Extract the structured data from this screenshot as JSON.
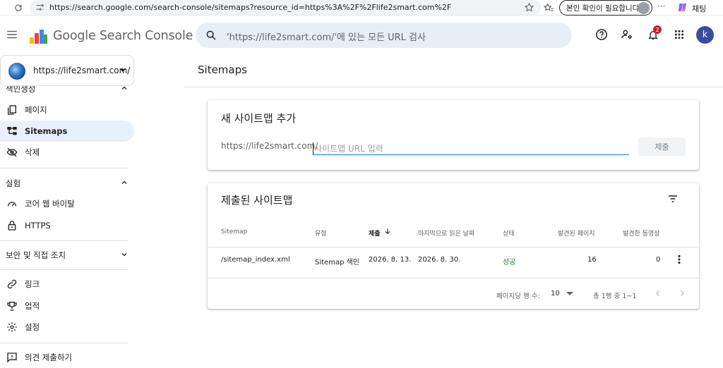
{
  "browser": {
    "url": "https://search.google.com/search-console/sitemaps?resource_id=https%3A%2F%2Flife2smart.com%2F",
    "signin_label": "본인 확인이 필요합니다.",
    "chat_label": "채팅",
    "more_label": "···"
  },
  "header": {
    "product_name": "Google Search Console",
    "search_placeholder": "'https://life2smart.com/'에 있는 모든 URL 검사",
    "notification_count": "2",
    "user_initial": "k"
  },
  "sidebar": {
    "property": "https://life2smart.com/",
    "section_indexing": "색인생성",
    "indexing_items": [
      {
        "label": "페이지",
        "icon": "pages-icon"
      },
      {
        "label": "Sitemaps",
        "icon": "sitemaps-icon"
      },
      {
        "label": "삭제",
        "icon": "removals-icon"
      }
    ],
    "section_experience": "실험",
    "experience_items": [
      {
        "label": "코어 웹 바이탈",
        "icon": "gauge-icon"
      },
      {
        "label": "HTTPS",
        "icon": "lock-icon"
      }
    ],
    "section_security": "보안 및 직접 조치",
    "other_items": [
      {
        "label": "링크",
        "icon": "link-icon"
      },
      {
        "label": "업적",
        "icon": "trophy-icon"
      },
      {
        "label": "설정",
        "icon": "gear-icon"
      }
    ],
    "feedback_label": "의견 제출하기"
  },
  "main": {
    "page_title": "Sitemaps",
    "add_card": {
      "title": "새 사이트맵 추가",
      "prefix": "https://life2smart.com/",
      "input_placeholder": "사이트맵 URL 입력",
      "input_value": "",
      "submit_label": "제출"
    },
    "submitted_card": {
      "title": "제출된 사이트맵",
      "columns": [
        "Sitemap",
        "유형",
        "제출",
        "마지막으로 읽은 날짜",
        "상태",
        "발견된 페이지",
        "발견한 동영상"
      ],
      "rows": [
        {
          "sitemap": "/sitemap_index.xml",
          "type": "Sitemap 색인",
          "submitted": "2026. 8. 13.",
          "last_read": "2026. 8. 30.",
          "status": "성공",
          "pages": "16",
          "videos": "0"
        }
      ],
      "rows_per_page_label": "페이지당 행 수:",
      "rows_per_page": "10",
      "range_label": "총 1행 중 1~1"
    }
  },
  "colors": {
    "accent": "#1a73e8",
    "active_bg": "#e8f0fe",
    "success": "#188038",
    "badge": "#c5221f"
  }
}
